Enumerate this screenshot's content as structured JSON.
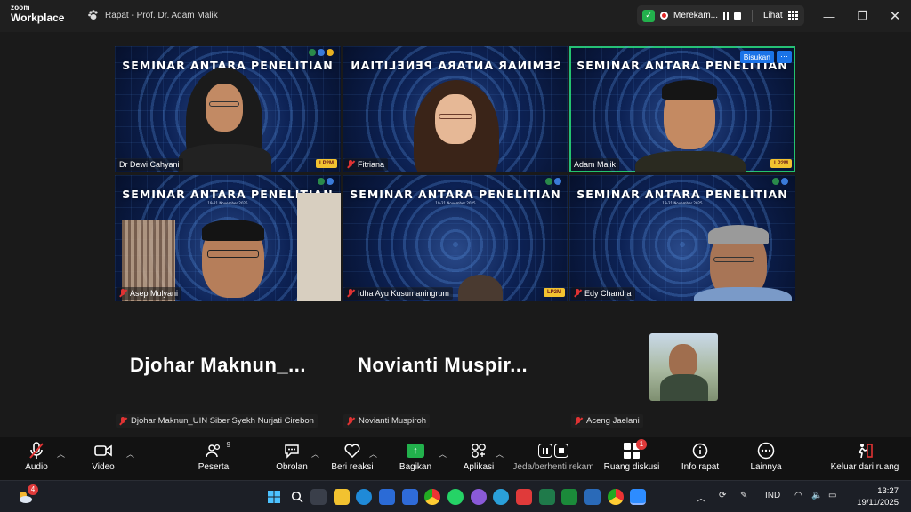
{
  "app": {
    "logo_line1": "zoom",
    "logo_line2": "Workplace"
  },
  "meeting": {
    "title": "Rapat - Prof. Dr. Adam Malik"
  },
  "recording": {
    "label": "Merekam...",
    "view_label": "Lihat"
  },
  "tiles": [
    {
      "name": "Dr Dewi Cahyani",
      "muted": false,
      "banner": "SEMINAR ANTARA PENELITIAN",
      "mirrored": false
    },
    {
      "name": "Fitriana",
      "muted": true,
      "banner": "SEMINAR ANTARA PENELITIAN",
      "mirrored": true
    },
    {
      "name": "Adam Malik",
      "muted": false,
      "banner": "SEMINAR ANTARA PENELITIAN",
      "mirrored": false,
      "active_speaker": true,
      "whisper_label": "Bisukan",
      "more_label": "···"
    },
    {
      "name": "Asep Mulyani",
      "muted": true,
      "banner": "SEMINAR ANTARA PENELITIAN",
      "date": "19-21 November 2025"
    },
    {
      "name": "Idha Ayu Kusumaningrum",
      "muted": true,
      "banner": "SEMINAR ANTARA PENELITIAN",
      "date": "19-21 November 2025"
    },
    {
      "name": "Edy Chandra",
      "muted": true,
      "banner": "SEMINAR ANTARA PENELITIAN",
      "date": "19-21 November 2025"
    }
  ],
  "lpm_label": "LP2M",
  "audio_only": [
    {
      "display": "Djohar  Maknun_...",
      "tag": "Djohar Maknun_UIN Siber Syekh Nurjati Cirebon"
    },
    {
      "display": "Novianti  Muspir...",
      "tag": "Novianti Muspiroh"
    },
    {
      "tag": "Aceng Jaelani"
    }
  ],
  "toolbar": {
    "audio": "Audio",
    "video": "Video",
    "participants": "Peserta",
    "participants_count": "9",
    "chat": "Obrolan",
    "reactions": "Beri reaksi",
    "share": "Bagikan",
    "apps": "Aplikasi",
    "pause_record": "Jeda/berhenti rekam",
    "breakout": "Ruang diskusi",
    "breakout_badge": "1",
    "info": "Info rapat",
    "more": "Lainnya",
    "leave": "Keluar dari ruang"
  },
  "taskbar": {
    "weather_badge": "4",
    "language": "IND",
    "time": "13:27",
    "date": "19/11/2025"
  },
  "colors": {
    "speaking_outline": "#23c46e",
    "share_green": "#22b14c",
    "muted_red": "#e03333",
    "whisper_blue": "#1a73e8"
  }
}
